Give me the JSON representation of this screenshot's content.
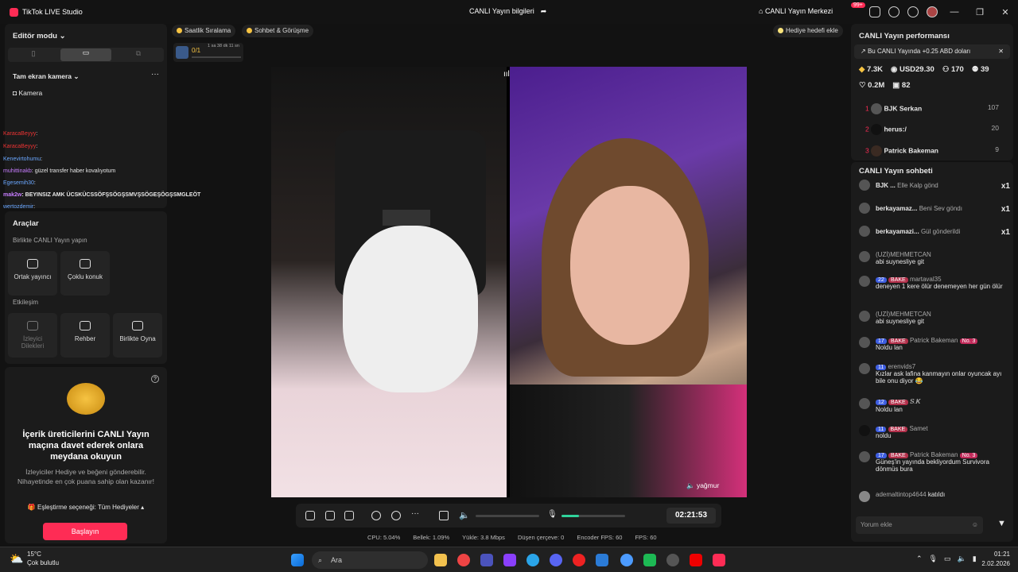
{
  "app": {
    "title": "TikTok LIVE Studio",
    "center_title": "CANLI Yayın bilgileri",
    "center_hub": "CANLI Yayın Merkezi",
    "notif_badge": "99+"
  },
  "left": {
    "mode": "Editör modu",
    "camera_section": "Tam ekran kamera",
    "camera": "Kamera",
    "chat": [
      {
        "user": "KaracaBeyyy",
        "sep": ":",
        "text": "",
        "color": "#e33"
      },
      {
        "user": "KaracaBeyyy",
        "sep": ":",
        "text": "",
        "color": "#e33"
      },
      {
        "user": "Kenevirtohumu",
        "sep": ":",
        "text": "",
        "color": "#6aa7ff"
      },
      {
        "user": "muhittinakb",
        "sep": ":",
        "text": "güzel transfer haber kovalıyotum",
        "color": "#c77dff"
      },
      {
        "user": "Egesemih30",
        "sep": ":",
        "text": "",
        "color": "#6aa7ff"
      },
      {
        "user": "mak2w",
        "sep": ":",
        "text": "BEYINSIZ AMK ÜCSKÜCSSÖFŞSÖGŞSMVŞSÖGEŞÖGŞSMGLEÖT",
        "color": "#c77dff"
      },
      {
        "user": "wertozdemir",
        "sep": ":",
        "text": "",
        "color": "#6aa7ff"
      }
    ]
  },
  "tools": {
    "title": "Araçlar",
    "sub1": "Birlikte CANLI Yayın yapın",
    "t1": "Ortak yayıncı",
    "t2": "Çoklu konuk",
    "sub2": "Etkileşim",
    "t3a": "İzleyici",
    "t3b": "Dilekleri",
    "t4": "Rehber",
    "t5": "Birlikte Oyna"
  },
  "promo": {
    "title": "İçerik üreticilerini CANLI Yayın maçına davet ederek onlara meydana okuyun",
    "desc": "İzleyiciler Hediye ve beğeni gönderebilir. Nihayetinde en çok puana sahip olan kazanır!",
    "match": "Eşleştirme seçeneği: Tüm Hediyeler",
    "start": "Başlayın"
  },
  "top": {
    "pill1": "Saatlik Sıralama",
    "pill2": "Sohbet & Görüşme",
    "goal": "Hediye hedefi ekle",
    "score": "0/1",
    "timer_small": "1 sa 38 dk 11 sn"
  },
  "stage": {
    "guest_label": "yağmur"
  },
  "controls": {
    "timer": "02:21:53"
  },
  "stats": {
    "cpu": "CPU: 5.04%",
    "mem": "Bellek: 1.09%",
    "upload": "Yükle: 3.8 Mbps",
    "dropped": "Düşen çerçeve: 0",
    "encoder": "Encoder FPS: 60",
    "fps": "FPS: 60"
  },
  "perf": {
    "title": "CANLI Yayın performansı",
    "banner": "Bu CANLI Yayında +0.25 ABD doları",
    "m1": "7.3K",
    "m2": "USD29.30",
    "m3": "170",
    "m4": "39",
    "m5": "0.2M",
    "m6": "82",
    "ranks": [
      {
        "n": "1",
        "name": "BJK Serkan",
        "v": "107"
      },
      {
        "n": "2",
        "name": "herus:/",
        "v": "20"
      },
      {
        "n": "3",
        "name": "Patrick Bakeman",
        "v": "9"
      }
    ]
  },
  "chat": {
    "title": "CANLI Yayın sohbeti",
    "gifts": [
      {
        "user": "BJK ...",
        "text": "Elle Kalp gönd",
        "count": "x1"
      },
      {
        "user": "berkayamaz...",
        "text": "Beni Sev göndı",
        "count": "x1"
      },
      {
        "user": "berkayamazi...",
        "text": "Gül gönderildi",
        "count": "x1"
      }
    ],
    "messages": [
      {
        "user": "(UZİ)MEHMETCAN",
        "text": "abi suynesliye git"
      },
      {
        "lvl": "22",
        "bake": "BAKE",
        "user": "martaval35",
        "text": "deneyen 1 kere ölür denemeyen her gün ölür"
      },
      {
        "user": "(UZİ)MEHMETCAN",
        "text": "abi suynesliye git"
      },
      {
        "lvl": "17",
        "bake": "BAKE",
        "user": "Patrick Bakeman",
        "rank": "No. 3",
        "text": "Noldu lan"
      },
      {
        "lvl": "11",
        "user": "erenvids7",
        "text": "Kızlar ask lafina kanmayın onlar oyuncak ayı bile onu diyor 😂"
      },
      {
        "lvl": "12",
        "bake": "BAKE",
        "user": "𝑺.𝑲",
        "text": "Noldu lan"
      },
      {
        "lvl": "11",
        "bake": "BAKE",
        "user": "Samet",
        "text": "noldu"
      },
      {
        "lvl": "17",
        "bake": "BAKE",
        "user": "Patrick Bakeman",
        "rank": "No. 3",
        "text": "Güneş'in yayında bekliyordum Survivora dönmüs bura"
      }
    ],
    "join_user": "ademaltintop4644",
    "join_text": "katıldı",
    "placeholder": "Yorum ekle"
  },
  "taskbar": {
    "temp": "15°C",
    "weather": "Çok bulutlu",
    "search": "Ara",
    "time": "01:21",
    "date": "2.02.2026"
  }
}
